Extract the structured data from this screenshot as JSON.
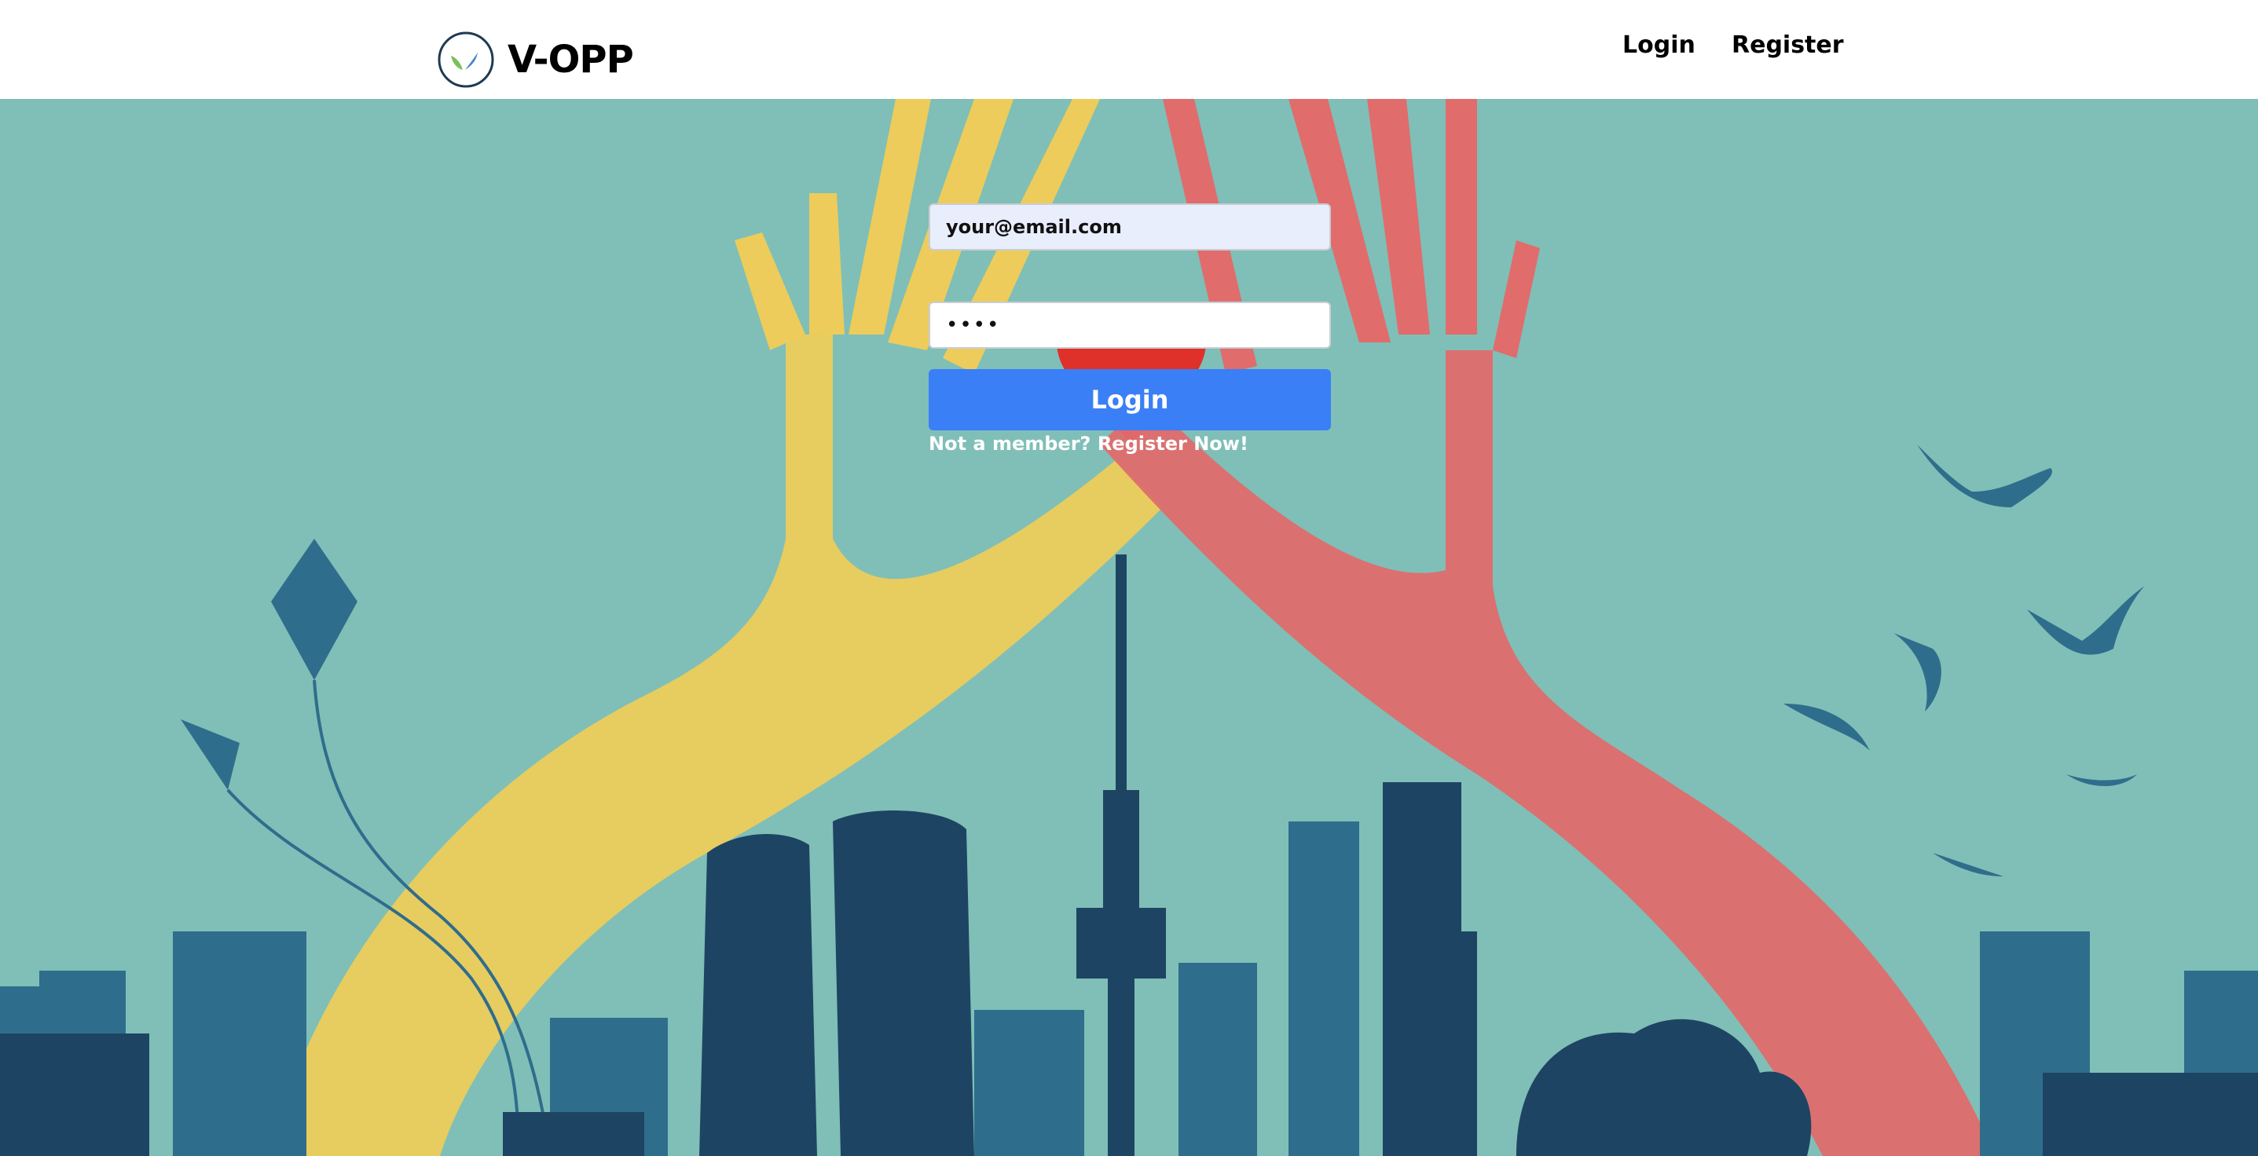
{
  "navbar": {
    "brand_name": "V-OPP",
    "login_label": "Login",
    "register_label": "Register"
  },
  "login_form": {
    "email_value": "your@email.com",
    "password_value": "••••",
    "submit_label": "Login",
    "register_prompt": "Not a member? Register Now!"
  },
  "colors": {
    "background_teal": "#7fbfb7",
    "skyline_dark": "#1e4463",
    "skyline_mid": "#2f6d8c",
    "yellow_hand": "#edcc5b",
    "red_hand": "#e06c6c",
    "button_blue": "#3a7ff6"
  }
}
